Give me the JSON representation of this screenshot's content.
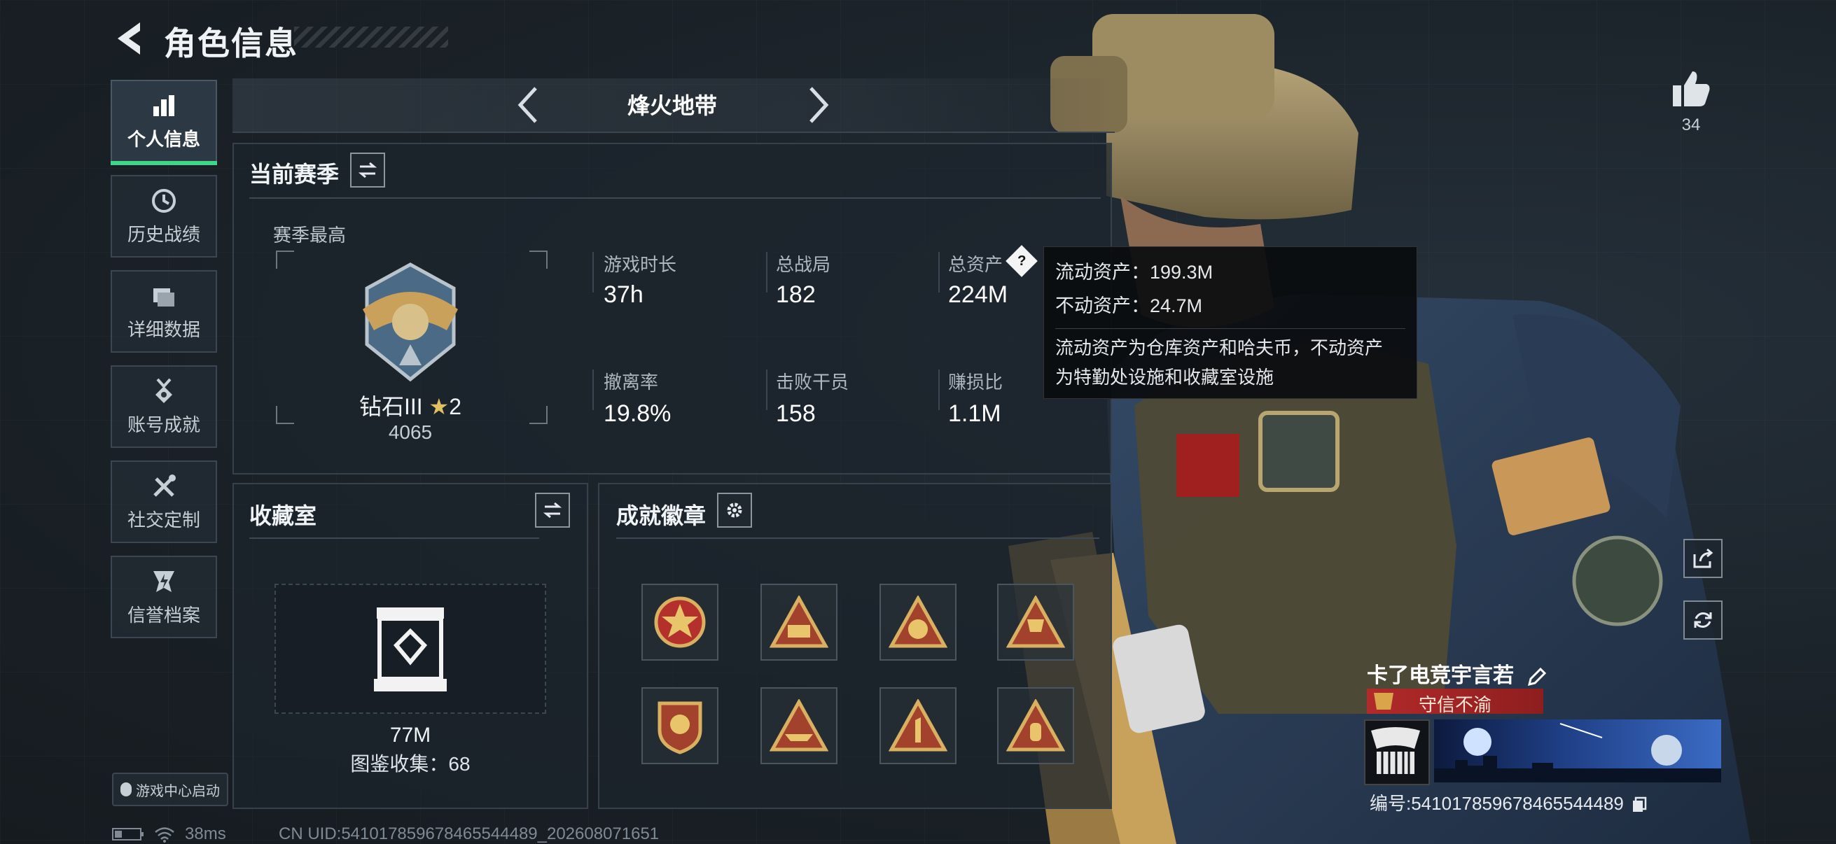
{
  "header": {
    "title": "角色信息"
  },
  "sidebar": {
    "items": [
      {
        "label": "个人信息",
        "icon": "bar-chart-icon",
        "active": true
      },
      {
        "label": "历史战绩",
        "icon": "history-clock-icon",
        "active": false
      },
      {
        "label": "详细数据",
        "icon": "folder-icon",
        "active": false
      },
      {
        "label": "账号成就",
        "icon": "achievement-medal-icon",
        "active": false
      },
      {
        "label": "社交定制",
        "icon": "tools-icon",
        "active": false
      },
      {
        "label": "信誉档案",
        "icon": "shield-bolt-icon",
        "active": false
      }
    ],
    "launch_label": "游戏中心启动"
  },
  "mode": {
    "title": "烽火地带"
  },
  "season": {
    "title": "当前赛季",
    "best_label": "赛季最高",
    "rank_name": "钻石III",
    "rank_stars": "2",
    "rank_points": "4065",
    "stats": [
      {
        "label": "游戏时长",
        "value": "37h"
      },
      {
        "label": "总战局",
        "value": "182"
      },
      {
        "label": "总资产",
        "value": "224M"
      },
      {
        "label": "撤离率",
        "value": "19.8%"
      },
      {
        "label": "击败干员",
        "value": "158"
      },
      {
        "label": "赚损比",
        "value": "1.1M"
      }
    ],
    "help_icon_text": "?"
  },
  "tooltip": {
    "liquid": "流动资产：199.3M",
    "fixed": "不动资产：24.7M",
    "desc_line1": "流动资产为仓库资产和哈夫币，不动资产",
    "desc_line2": "为特勤处设施和收藏室设施"
  },
  "collection": {
    "title": "收藏室",
    "value": "77M",
    "catalog": "图鉴收集：68"
  },
  "achievements": {
    "title": "成就徽章",
    "badges": [
      "star-emblem-icon",
      "triangle-crew-icon",
      "triangle-helmet-icon",
      "triangle-trophy-icon",
      "shield-crest-icon",
      "triangle-boat-icon",
      "triangle-number-one-icon",
      "triangle-hand-icon"
    ]
  },
  "profile": {
    "likes": "34",
    "name": "卡了电竞宇言若",
    "honor_title": "守信不渝",
    "id_text": "编号:541017859678465544489"
  },
  "footer": {
    "ping": "38ms",
    "uid": "CN UID:541017859678465544489_202608071651"
  },
  "colors": {
    "accent": "#3fd68a",
    "honor_red": "#b22a2a",
    "panel_border": "#36414c"
  }
}
